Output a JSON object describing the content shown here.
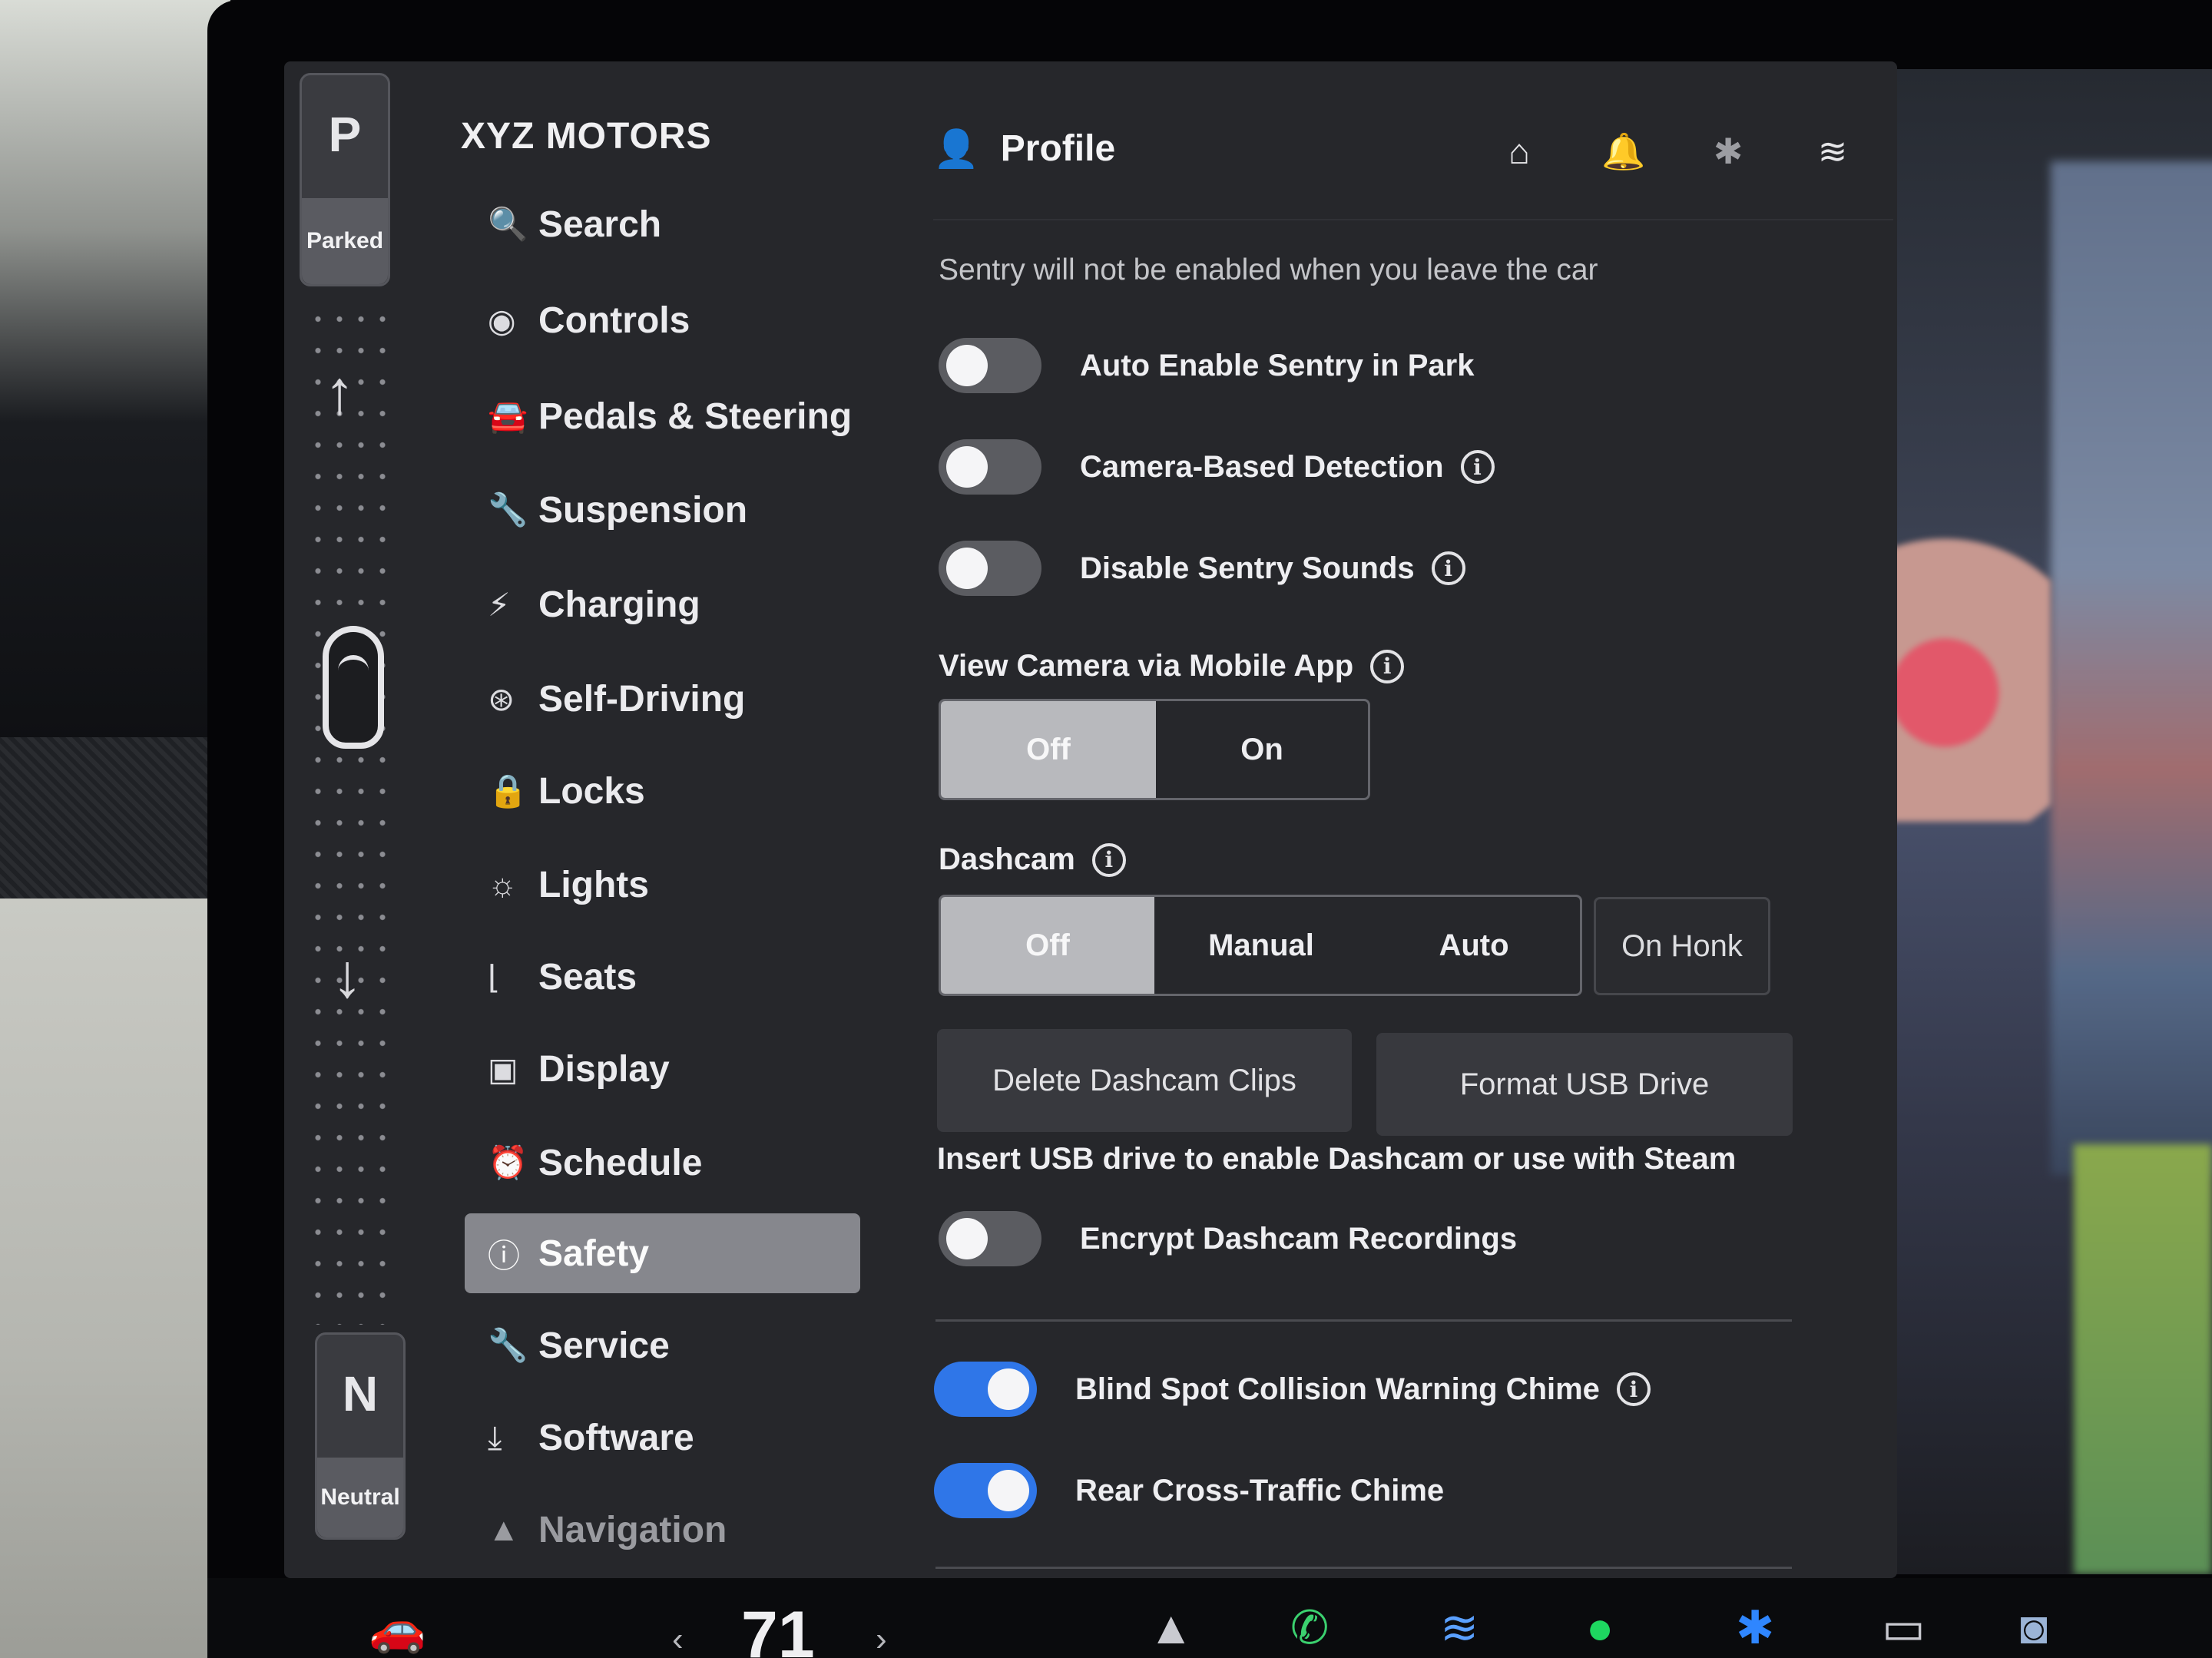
{
  "gear": {
    "top_letter": "P",
    "top_state": "Parked",
    "bottom_letter": "N",
    "bottom_state": "Neutral"
  },
  "brand": "XYZ MOTORS",
  "menu": [
    {
      "label": "Search",
      "icon": "search-icon",
      "glyph": "🔍"
    },
    {
      "label": "Controls",
      "icon": "toggle-icon",
      "glyph": "◉"
    },
    {
      "label": "Pedals & Steering",
      "icon": "car-icon",
      "glyph": "🚘"
    },
    {
      "label": "Suspension",
      "icon": "shock-absorber-icon",
      "glyph": "🔧"
    },
    {
      "label": "Charging",
      "icon": "lightning-icon",
      "glyph": "⚡"
    },
    {
      "label": "Self-Driving",
      "icon": "steering-wheel-icon",
      "glyph": "⊛"
    },
    {
      "label": "Locks",
      "icon": "lock-icon",
      "glyph": "🔒"
    },
    {
      "label": "Lights",
      "icon": "sun-icon",
      "glyph": "☼"
    },
    {
      "label": "Seats",
      "icon": "seat-icon",
      "glyph": "⌊"
    },
    {
      "label": "Display",
      "icon": "display-icon",
      "glyph": "▣"
    },
    {
      "label": "Schedule",
      "icon": "alarm-clock-icon",
      "glyph": "⏰"
    },
    {
      "label": "Safety",
      "icon": "safety-icon",
      "glyph": "ⓘ",
      "active": true
    },
    {
      "label": "Service",
      "icon": "wrench-icon",
      "glyph": "🔧"
    },
    {
      "label": "Software",
      "icon": "download-icon",
      "glyph": "⤓"
    },
    {
      "label": "Navigation",
      "icon": "navigation-arrow-icon",
      "glyph": "▲",
      "faded": true
    }
  ],
  "header": {
    "profile_label": "Profile",
    "icons": [
      "garage-icon",
      "bell-icon",
      "bluetooth-icon",
      "wifi-icon"
    ]
  },
  "content": {
    "sentry_message": "Sentry will not be enabled when you leave the car",
    "toggles_top": [
      {
        "label": "Auto Enable Sentry in Park",
        "on": false,
        "info": false
      },
      {
        "label": "Camera-Based Detection",
        "on": false,
        "info": true
      },
      {
        "label": "Disable Sentry Sounds",
        "on": false,
        "info": true
      }
    ],
    "view_camera": {
      "title": "View Camera via Mobile App",
      "options": [
        "Off",
        "On"
      ],
      "selected": "Off"
    },
    "dashcam": {
      "title": "Dashcam",
      "options": [
        "Off",
        "Manual",
        "Auto"
      ],
      "extra": "On Honk",
      "selected": "Off"
    },
    "buttons": {
      "delete": "Delete Dashcam Clips",
      "format": "Format USB Drive"
    },
    "usb_hint": "Insert USB drive to enable Dashcam or use with Steam",
    "encrypt": {
      "label": "Encrypt Dashcam Recordings",
      "on": false
    },
    "toggles_bottom": [
      {
        "label": "Blind Spot Collision Warning Chime",
        "on": true,
        "info": true
      },
      {
        "label": "Rear Cross-Traffic Chime",
        "on": true,
        "info": false
      }
    ]
  },
  "taskbar": {
    "temperature": "71",
    "left_arrow": "‹",
    "right_arrow": "›"
  },
  "colors": {
    "accent_toggle": "#2f76e8",
    "screen_bg": "#26272b",
    "active_menu": "#86878d"
  }
}
